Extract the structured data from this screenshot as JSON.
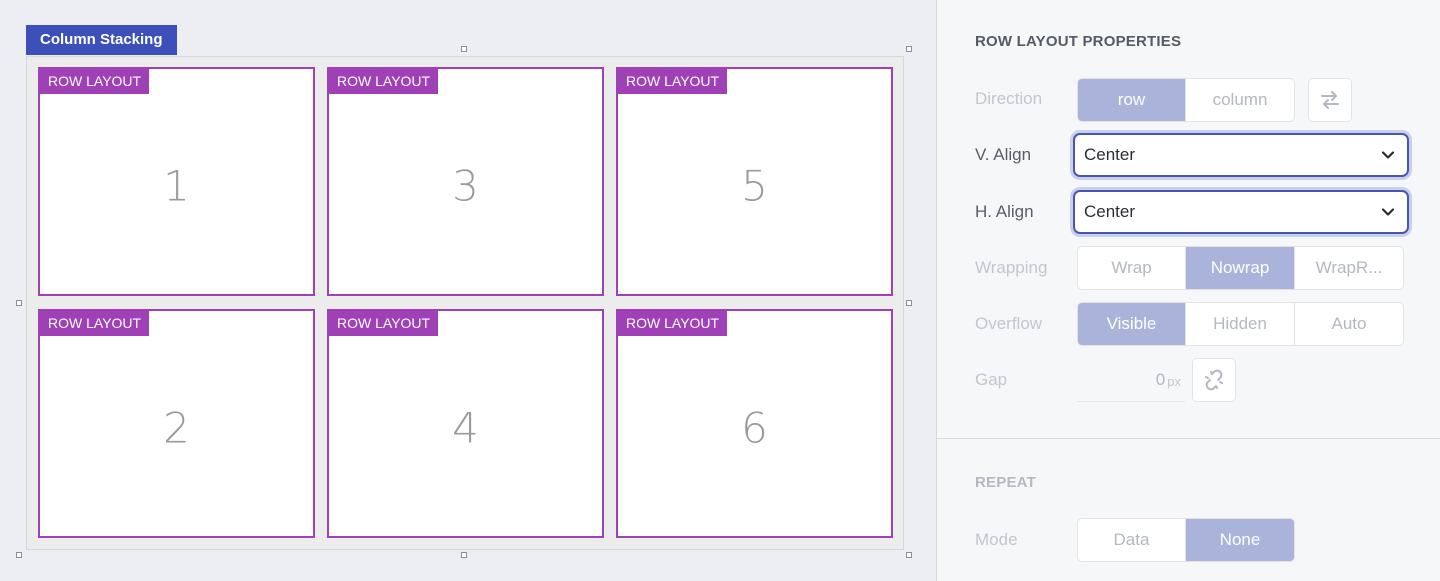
{
  "canvas": {
    "container_label": "Column Stacking",
    "cells": [
      {
        "tag": "ROW LAYOUT",
        "number": "1"
      },
      {
        "tag": "ROW LAYOUT",
        "number": "3"
      },
      {
        "tag": "ROW LAYOUT",
        "number": "5"
      },
      {
        "tag": "ROW LAYOUT",
        "number": "2"
      },
      {
        "tag": "ROW LAYOUT",
        "number": "4"
      },
      {
        "tag": "ROW LAYOUT",
        "number": "6"
      }
    ]
  },
  "panel": {
    "section_title": "ROW LAYOUT PROPERTIES",
    "direction": {
      "label": "Direction",
      "options": [
        "row",
        "column"
      ],
      "selected": "row",
      "swap_icon": "swap-arrows-icon"
    },
    "v_align": {
      "label": "V. Align",
      "value": "Center",
      "icon": "chevron-down-icon"
    },
    "h_align": {
      "label": "H. Align",
      "value": "Center",
      "icon": "chevron-down-icon"
    },
    "wrapping": {
      "label": "Wrapping",
      "options": [
        "Wrap",
        "Nowrap",
        "WrapR..."
      ],
      "selected": "Nowrap"
    },
    "overflow": {
      "label": "Overflow",
      "options": [
        "Visible",
        "Hidden",
        "Auto"
      ],
      "selected": "Visible"
    },
    "gap": {
      "label": "Gap",
      "value": "0",
      "unit": "px",
      "link_icon": "unlink-icon"
    },
    "repeat_title": "REPEAT",
    "mode": {
      "label": "Mode",
      "options": [
        "Data",
        "None"
      ],
      "selected": "None"
    }
  },
  "colors": {
    "accent": "#3d4fb8",
    "row_layout": "#a040b6",
    "selected_segment": "#aab3da"
  }
}
